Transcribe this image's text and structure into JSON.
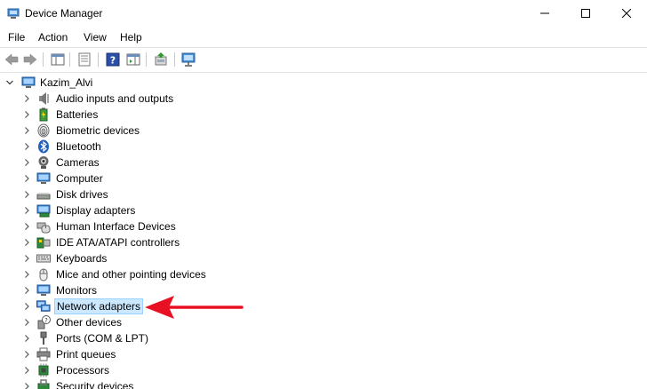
{
  "window": {
    "title": "Device Manager",
    "minimize_icon": "minimize-icon",
    "maximize_icon": "maximize-icon",
    "close_icon": "close-icon"
  },
  "menu": {
    "items": [
      "File",
      "Action",
      "View",
      "Help"
    ]
  },
  "toolbar": {
    "buttons": [
      "back-arrow-icon",
      "forward-arrow-icon",
      "show-hide-console-tree-icon",
      "properties-icon",
      "help-icon",
      "action-pane-icon",
      "update-driver-icon",
      "scan-hardware-icon"
    ]
  },
  "tree": {
    "root": {
      "label": "Kazim_Alvi",
      "icon": "computer-icon"
    },
    "items": [
      {
        "label": "Audio inputs and outputs",
        "icon": "speaker-icon"
      },
      {
        "label": "Batteries",
        "icon": "battery-icon"
      },
      {
        "label": "Biometric devices",
        "icon": "fingerprint-icon"
      },
      {
        "label": "Bluetooth",
        "icon": "bluetooth-icon"
      },
      {
        "label": "Cameras",
        "icon": "camera-icon"
      },
      {
        "label": "Computer",
        "icon": "monitor-icon"
      },
      {
        "label": "Disk drives",
        "icon": "disk-drive-icon"
      },
      {
        "label": "Display adapters",
        "icon": "display-adapter-icon"
      },
      {
        "label": "Human Interface Devices",
        "icon": "hid-icon"
      },
      {
        "label": "IDE ATA/ATAPI controllers",
        "icon": "ide-controller-icon"
      },
      {
        "label": "Keyboards",
        "icon": "keyboard-icon"
      },
      {
        "label": "Mice and other pointing devices",
        "icon": "mouse-icon"
      },
      {
        "label": "Monitors",
        "icon": "monitor-icon"
      },
      {
        "label": "Network adapters",
        "icon": "network-adapter-icon",
        "selected": true
      },
      {
        "label": "Other devices",
        "icon": "unknown-device-icon"
      },
      {
        "label": "Ports (COM & LPT)",
        "icon": "port-icon"
      },
      {
        "label": "Print queues",
        "icon": "printer-icon"
      },
      {
        "label": "Processors",
        "icon": "processor-icon"
      },
      {
        "label": "Security devices",
        "icon": "security-device-icon"
      }
    ]
  },
  "colors": {
    "selection_bg": "#cce8ff",
    "selection_border": "#99d1ff",
    "annotation_arrow": "#e81123"
  }
}
